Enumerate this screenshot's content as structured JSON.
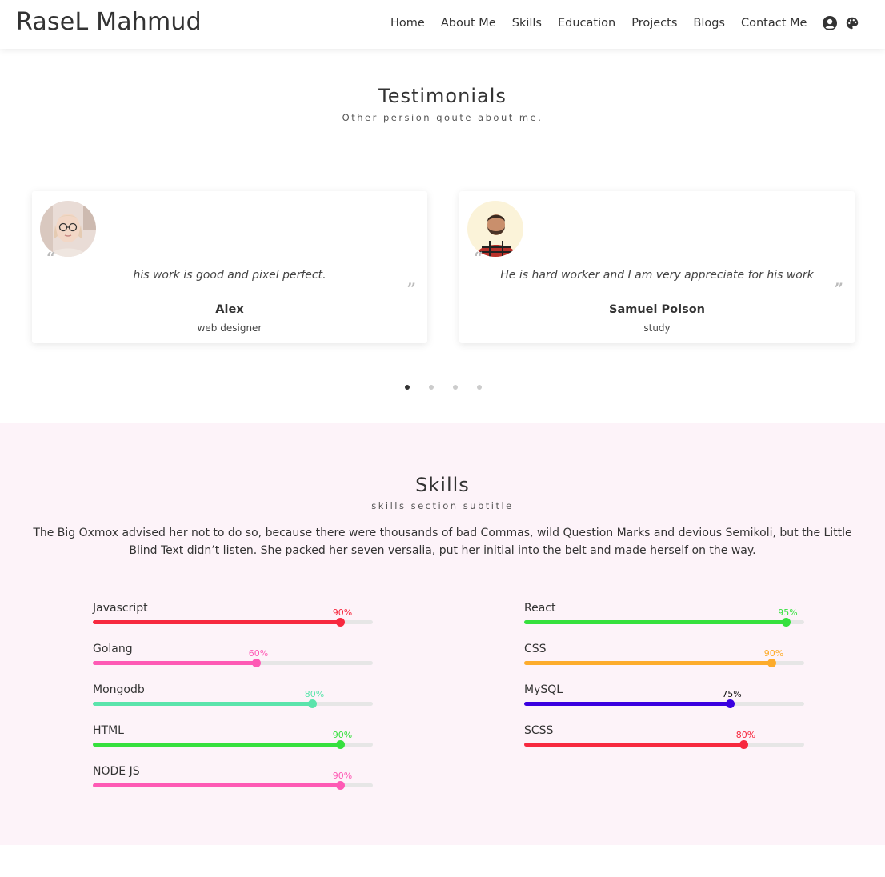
{
  "header": {
    "brand": "RaseL Mahmud",
    "nav": [
      "Home",
      "About Me",
      "Skills",
      "Education",
      "Projects",
      "Blogs",
      "Contact Me"
    ],
    "icons": [
      "user-circle-icon",
      "palette-icon"
    ]
  },
  "testimonials": {
    "title": "Testimonials",
    "subtitle": "Other persion qoute about me.",
    "cards": [
      {
        "quote": "his work is good and pixel perfect.",
        "name": "Alex",
        "role": "web designer"
      },
      {
        "quote": "He is hard worker and I am very appreciate for his work",
        "name": "Samuel Polson",
        "role": "study"
      }
    ],
    "dots": 4,
    "active_dot": 0
  },
  "skills": {
    "title": "Skills",
    "subtitle": "skills section subtitle",
    "description": "The Big Oxmox advised her not to do so, because there were thousands of bad Commas, wild Question Marks and devious Semikoli, but the Little Blind Text didn’t listen. She packed her seven versalia, put her initial into the belt and made herself on the way.",
    "left": [
      {
        "name": "Javascript",
        "percent": 90,
        "label": "90%",
        "color": "#f7293f",
        "label_color": "#f7293f"
      },
      {
        "name": "Golang",
        "percent": 60,
        "label": "60%",
        "color": "#fe5ab5",
        "label_color": "#fe5ab5"
      },
      {
        "name": "Mongodb",
        "percent": 80,
        "label": "80%",
        "color": "#5be4ac",
        "label_color": "#5be4ac"
      },
      {
        "name": "HTML",
        "percent": 90,
        "label": "90%",
        "color": "#36e03e",
        "label_color": "#36e03e"
      },
      {
        "name": "NODE JS",
        "percent": 90,
        "label": "90%",
        "color": "#fe5ab5",
        "label_color": "#fe5ab5"
      }
    ],
    "right": [
      {
        "name": "React",
        "percent": 95,
        "label": "95%",
        "color": "#36e03e",
        "label_color": "#36e03e"
      },
      {
        "name": "CSS",
        "percent": 90,
        "label": "90%",
        "color": "#fdac2c",
        "label_color": "#fdac2c"
      },
      {
        "name": "MySQL",
        "percent": 75,
        "label": "75%",
        "color": "#3a00e0",
        "label_color": "#111111"
      },
      {
        "name": "SCSS",
        "percent": 80,
        "label": "80%",
        "color": "#f7293f",
        "label_color": "#f7293f"
      }
    ]
  }
}
